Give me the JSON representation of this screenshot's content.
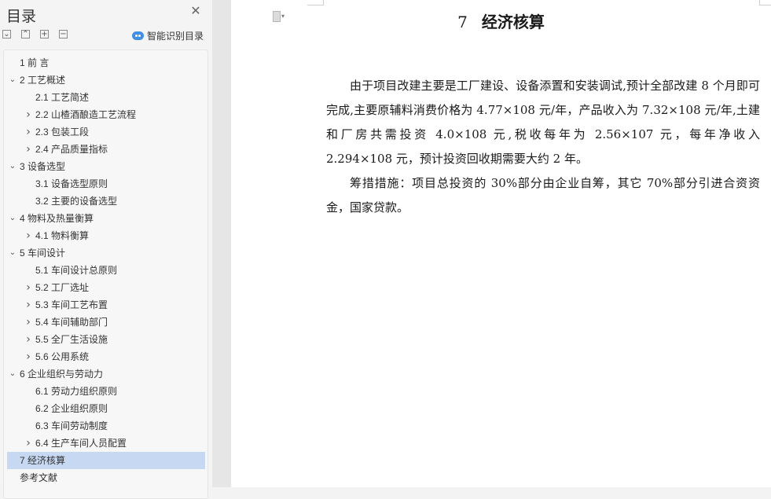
{
  "sidebar": {
    "title": "目录",
    "close_icon": "close-icon",
    "controls": [
      "collapse-all-icon",
      "expand-all-icon",
      "add-icon",
      "remove-icon"
    ],
    "smart_button": "智能识别目录",
    "toc": [
      {
        "label": "1   前  言",
        "arrow": ""
      },
      {
        "label": "2   工艺概述",
        "arrow": "expanded"
      },
      {
        "label": "2.1  工艺简述",
        "arrow": ""
      },
      {
        "label": "2.2  山楂酒酿造工艺流程",
        "arrow": "collapsed"
      },
      {
        "label": "2.3 包装工段",
        "arrow": "collapsed"
      },
      {
        "label": "2.4 产品质量指标",
        "arrow": "collapsed"
      },
      {
        "label": "3   设备选型",
        "arrow": "expanded"
      },
      {
        "label": "3.1 设备选型原则",
        "arrow": ""
      },
      {
        "label": "3.2 主要的设备选型",
        "arrow": ""
      },
      {
        "label": "4   物料及热量衡算",
        "arrow": "expanded"
      },
      {
        "label": "4.1 物料衡算",
        "arrow": "collapsed"
      },
      {
        "label": "5   车间设计",
        "arrow": "expanded"
      },
      {
        "label": "5.1 车间设计总原则",
        "arrow": ""
      },
      {
        "label": "5.2  工厂选址",
        "arrow": "collapsed"
      },
      {
        "label": "5.3  车间工艺布置",
        "arrow": "collapsed"
      },
      {
        "label": "5.4 车间辅助部门",
        "arrow": "collapsed"
      },
      {
        "label": "5.5 全厂生活设施",
        "arrow": "collapsed"
      },
      {
        "label": "5.6 公用系统",
        "arrow": "collapsed"
      },
      {
        "label": "6   企业组织与劳动力",
        "arrow": "expanded"
      },
      {
        "label": "6.1 劳动力组织原则",
        "arrow": ""
      },
      {
        "label": "6.2 企业组织原则",
        "arrow": ""
      },
      {
        "label": "6.3 车间劳动制度",
        "arrow": ""
      },
      {
        "label": "6.4 生产车间人员配置",
        "arrow": "collapsed"
      },
      {
        "label": "7   经济核算",
        "arrow": "",
        "active": true
      },
      {
        "label": "参考文献",
        "arrow": ""
      }
    ]
  },
  "document": {
    "heading_number": "7",
    "heading_title": "经济核算",
    "paragraphs": [
      "由于项目改建主要是工厂建设、设备添置和安装调试,预计全部改建 8 个月即可完成,主要原辅料消费价格为 4.77×108 元/年，产品收入为 7.32×108 元/年,土建和厂房共需投资 4.0×108 元,税收每年为 2.56×107 元，每年净收入 2.294×108 元，预计投资回收期需要大约 2 年。",
      "筹措措施：项目总投资的 30%部分由企业自筹，其它 70%部分引进合资资金，国家贷款。"
    ]
  },
  "colors": {
    "active_item": "#c7d8f3",
    "smart_icon": "#3f8fe6"
  }
}
